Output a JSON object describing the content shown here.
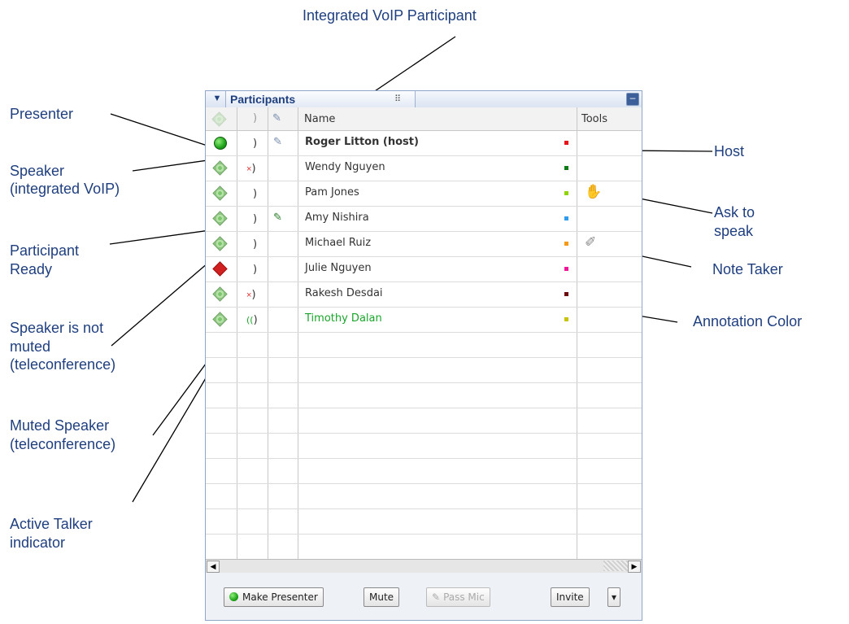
{
  "callouts": {
    "integrated_voip": "Integrated VoIP Participant",
    "presenter": "Presenter",
    "speaker_voip_1": "Speaker",
    "speaker_voip_2": "(integrated VoIP)",
    "participant_ready_1": "Participant",
    "participant_ready_2": "Ready",
    "speaker_not_muted_1": "Speaker is not",
    "speaker_not_muted_2": "muted",
    "speaker_not_muted_3": "(teleconference)",
    "muted_speaker_1": "Muted Speaker",
    "muted_speaker_2": "(teleconference)",
    "active_talker_1": "Active Talker",
    "active_talker_2": "indicator",
    "host": "Host",
    "ask_to_speak_1": "Ask to",
    "ask_to_speak_2": "speak",
    "note_taker": "Note Taker",
    "annotation_color": "Annotation Color"
  },
  "panel": {
    "title": "Participants",
    "columns": {
      "name": "Name",
      "tools": "Tools"
    }
  },
  "participants": [
    {
      "name": "Roger Litton (host)",
      "status": "presenter",
      "audio": "phone-icon",
      "mic": "mic-icon",
      "color": "#e8141b",
      "tool": ""
    },
    {
      "name": "Wendy Nguyen",
      "status": "ready",
      "audio": "muted-phone-icon",
      "mic": "",
      "color": "#0e7a16",
      "tool": ""
    },
    {
      "name": "Pam Jones",
      "status": "ready",
      "audio": "phone-icon",
      "mic": "",
      "color": "#8fd400",
      "tool": "hand-icon"
    },
    {
      "name": "Amy Nishira",
      "status": "ready",
      "audio": "phone-icon",
      "mic": "active-mic-icon",
      "color": "#2f9cf0",
      "tool": ""
    },
    {
      "name": "Michael Ruiz",
      "status": "ready",
      "audio": "phone-icon",
      "mic": "",
      "color": "#f59a14",
      "tool": "pencil-icon"
    },
    {
      "name": "Julie Nguyen",
      "status": "not-ready",
      "audio": "phone-icon",
      "mic": "",
      "color": "#f0179b",
      "tool": ""
    },
    {
      "name": "Rakesh Desdai",
      "status": "ready",
      "audio": "muted-phone-icon",
      "mic": "",
      "color": "#6b0b0b",
      "tool": ""
    },
    {
      "name": "Timothy Dalan",
      "status": "ready",
      "audio": "talking-phone-icon",
      "mic": "",
      "color": "#c9c400",
      "tool": ""
    }
  ],
  "buttons": {
    "make_presenter": "Make Presenter",
    "mute": "Mute",
    "pass_mic": "Pass Mic",
    "invite": "Invite"
  },
  "icons": {
    "phone": ")",
    "muted_x": "×",
    "talk": "((",
    "mic": "✎",
    "hand": "✋",
    "pencil": "✐",
    "collapse": "▼",
    "minimize": "–",
    "dropdown": "▾",
    "left": "◀",
    "right": "▶"
  }
}
